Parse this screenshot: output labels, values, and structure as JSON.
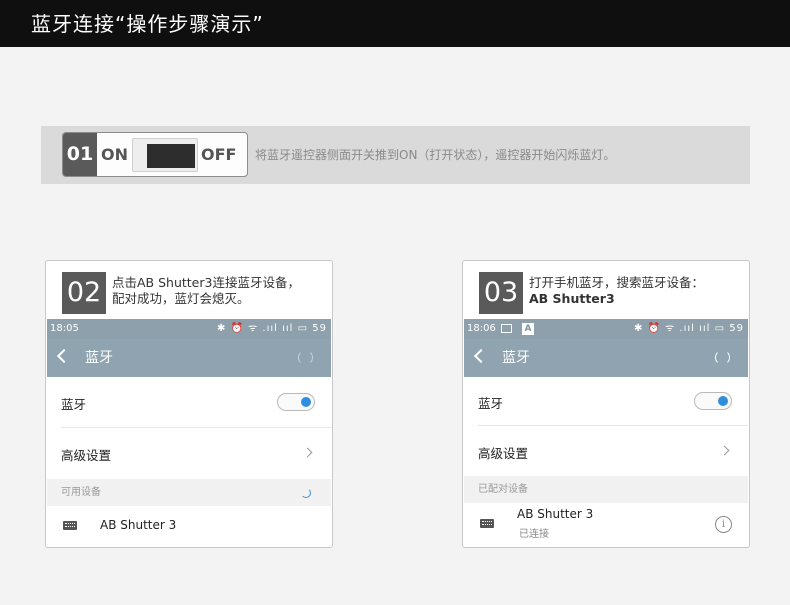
{
  "header": {
    "title": "蓝牙连接“操作步骤演示”"
  },
  "step1": {
    "number": "01",
    "switch_on_label": "ON",
    "switch_off_label": "OFF",
    "description": "将蓝牙遥控器侧面开关推到ON（打开状态），遥控器开始闪烁蓝灯。"
  },
  "step2": {
    "number": "02",
    "description_line1": "点击AB Shutter3连接蓝牙设备，",
    "description_line2": "配对成功，蓝灯会熄灭。",
    "phone": {
      "status_time": "18:05",
      "status_icons": "✱ ⏰ ᯤ .ııl ııl ▭ 59",
      "appbar_title": "蓝牙",
      "bluetooth_row_label": "蓝牙",
      "bluetooth_enabled": true,
      "advanced_settings_label": "高级设置",
      "section_label": "可用设备",
      "device_name": "AB Shutter 3"
    }
  },
  "step3": {
    "number": "03",
    "description_line1": "打开手机蓝牙，搜索蓝牙设备：",
    "description_line2": "AB Shutter3",
    "phone": {
      "status_time": "18:06",
      "status_a_icon": "A",
      "status_icons": "✱ ⏰ ᯤ .ııl ııl ▭ 59",
      "appbar_title": "蓝牙",
      "bluetooth_row_label": "蓝牙",
      "bluetooth_enabled": true,
      "advanced_settings_label": "高级设置",
      "section_label": "已配对设备",
      "device_name": "AB Shutter 3",
      "device_status": "已连接",
      "info_glyph": "i"
    }
  },
  "colors": {
    "header_bg": "#0f0f0f",
    "page_bg": "#f3f3f3",
    "badge_bg": "#5a5a5a",
    "phone_appbar": "#8fa4b0",
    "toggle_on": "#2f8fde"
  }
}
